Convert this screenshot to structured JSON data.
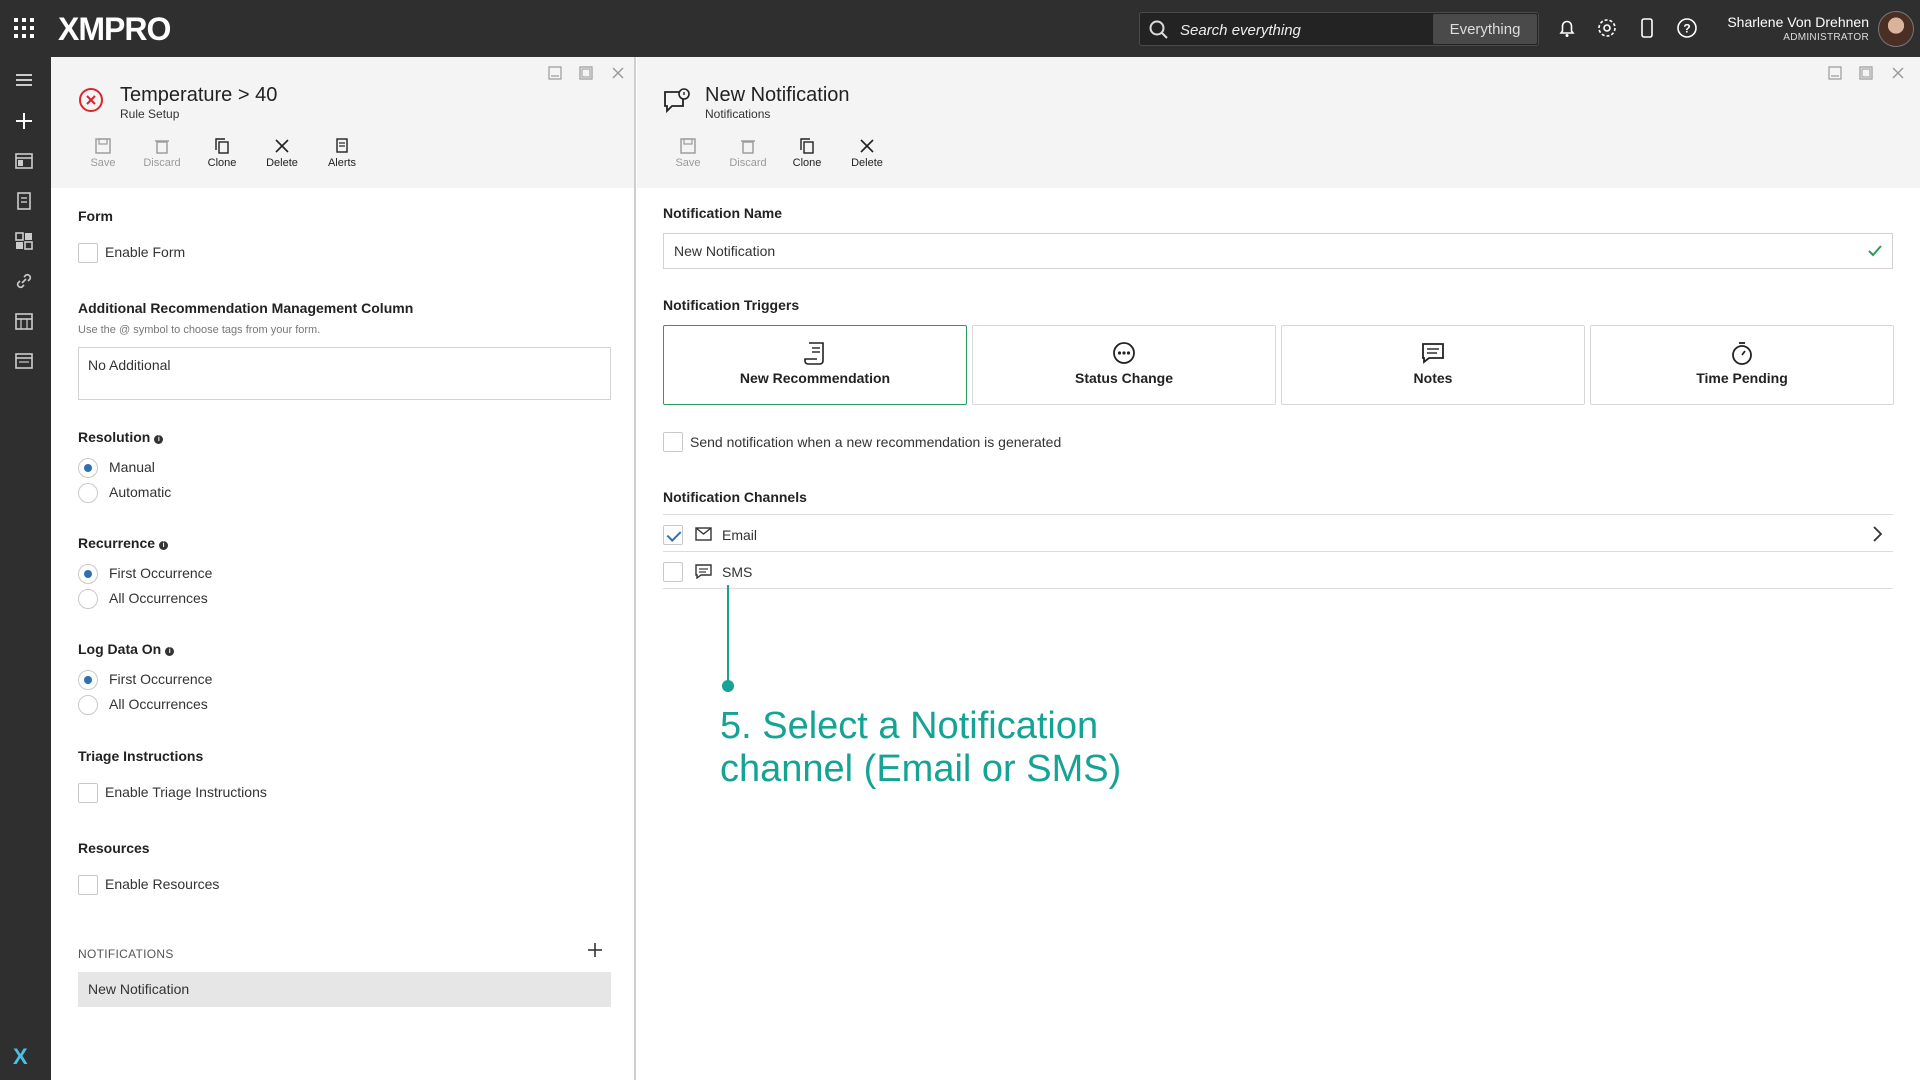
{
  "topbar": {
    "logo": "XMPRO",
    "search_placeholder": "Search everything",
    "scope": "Everything",
    "user_name": "Sharlene Von Drehnen",
    "user_role": "ADMINISTRATOR"
  },
  "left": {
    "title": "Temperature > 40",
    "subtitle": "Rule Setup",
    "tools": {
      "save": "Save",
      "discard": "Discard",
      "clone": "Clone",
      "delete": "Delete",
      "alerts": "Alerts"
    },
    "form": {
      "label": "Form",
      "enable": "Enable Form"
    },
    "additional": {
      "label": "Additional Recommendation Management Column",
      "hint": "Use the @ symbol to choose tags from your form.",
      "value": "No Additional"
    },
    "resolution": {
      "label": "Resolution",
      "opt1": "Manual",
      "opt2": "Automatic",
      "selected": "Manual"
    },
    "recurrence": {
      "label": "Recurrence",
      "opt1": "First Occurrence",
      "opt2": "All Occurrences",
      "selected": "First Occurrence"
    },
    "logdata": {
      "label": "Log Data On",
      "opt1": "First Occurrence",
      "opt2": "All Occurrences",
      "selected": "First Occurrence"
    },
    "triage": {
      "label": "Triage Instructions",
      "enable": "Enable Triage Instructions"
    },
    "resources": {
      "label": "Resources",
      "enable": "Enable Resources"
    },
    "notifications": {
      "header": "NOTIFICATIONS",
      "items": [
        "New Notification"
      ]
    }
  },
  "right": {
    "title": "New Notification",
    "subtitle": "Notifications",
    "tools": {
      "save": "Save",
      "discard": "Discard",
      "clone": "Clone",
      "delete": "Delete"
    },
    "name_label": "Notification Name",
    "name_value": "New Notification",
    "triggers_label": "Notification Triggers",
    "triggers": [
      "New Recommendation",
      "Status Change",
      "Notes",
      "Time Pending"
    ],
    "active_trigger": "New Recommendation",
    "send_label": "Send notification when a new recommendation is generated",
    "channels_label": "Notification Channels",
    "channels": [
      {
        "label": "Email",
        "checked": true
      },
      {
        "label": "SMS",
        "checked": false
      }
    ]
  },
  "callout": {
    "line1": "5. Select a Notification",
    "line2": "channel (Email or SMS)"
  },
  "colors": {
    "accent": "#14a394",
    "active_border": "#2a9d5c",
    "radio": "#2e6fb5"
  }
}
